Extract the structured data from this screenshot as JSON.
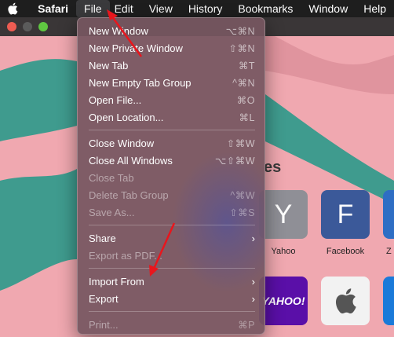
{
  "menubar": {
    "app_name": "Safari",
    "items": [
      "File",
      "Edit",
      "View",
      "History",
      "Bookmarks",
      "Window",
      "Help"
    ]
  },
  "file_menu": {
    "new_window": {
      "label": "New Window",
      "shortcut": "⌥⌘N"
    },
    "new_private_window": {
      "label": "New Private Window",
      "shortcut": "⇧⌘N"
    },
    "new_tab": {
      "label": "New Tab",
      "shortcut": "⌘T"
    },
    "new_empty_tab_group": {
      "label": "New Empty Tab Group",
      "shortcut": "^⌘N"
    },
    "open_file": {
      "label": "Open File...",
      "shortcut": "⌘O"
    },
    "open_location": {
      "label": "Open Location...",
      "shortcut": "⌘L"
    },
    "close_window": {
      "label": "Close Window",
      "shortcut": "⇧⌘W"
    },
    "close_all_windows": {
      "label": "Close All Windows",
      "shortcut": "⌥⇧⌘W"
    },
    "close_tab": {
      "label": "Close Tab",
      "shortcut": ""
    },
    "delete_tab_group": {
      "label": "Delete Tab Group",
      "shortcut": "^⌘W"
    },
    "save_as": {
      "label": "Save As...",
      "shortcut": "⇧⌘S"
    },
    "share": {
      "label": "Share"
    },
    "export_as_pdf": {
      "label": "Export as PDF..."
    },
    "import_from": {
      "label": "Import From"
    },
    "export": {
      "label": "Export"
    },
    "print": {
      "label": "Print...",
      "shortcut": "⌘P"
    }
  },
  "favorites": {
    "heading": "es",
    "tiles": [
      {
        "letter": "Y",
        "label": "Yahoo"
      },
      {
        "letter": "F",
        "label": "Facebook"
      },
      {
        "letter": "",
        "label": "Z"
      },
      {
        "letter": "YAHOO!",
        "label": ""
      },
      {
        "letter": "",
        "label": ""
      }
    ]
  },
  "colors": {
    "background_pink": "#f0a8b0",
    "teal": "#3f9b8e",
    "menubar": "#1e1e1e",
    "arrow": "#e8161d"
  }
}
